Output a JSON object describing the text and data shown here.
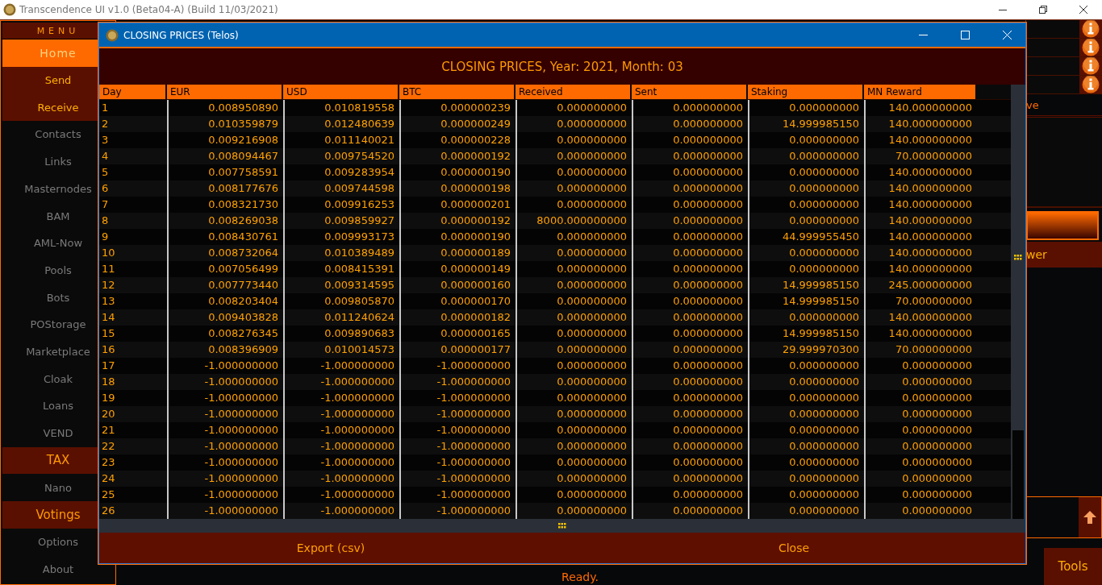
{
  "app_window": {
    "title": "Transcendence UI v1.0 (Beta04-A) (Build 11/03/2021)"
  },
  "sidebar": {
    "header": "MENU",
    "items": [
      {
        "label": "Home",
        "kind": "item",
        "selected": true,
        "disabled": false
      },
      {
        "label": "Send",
        "kind": "item",
        "selected": false,
        "disabled": false
      },
      {
        "label": "Receive",
        "kind": "item",
        "selected": false,
        "disabled": false
      },
      {
        "label": "Contacts",
        "kind": "item",
        "selected": false,
        "disabled": true
      },
      {
        "label": "Links",
        "kind": "item",
        "selected": false,
        "disabled": true
      },
      {
        "label": "Masternodes",
        "kind": "item",
        "selected": false,
        "disabled": true
      },
      {
        "label": "BAM",
        "kind": "item",
        "selected": false,
        "disabled": true
      },
      {
        "label": "AML-Now",
        "kind": "item",
        "selected": false,
        "disabled": true
      },
      {
        "label": "Pools",
        "kind": "item",
        "selected": false,
        "disabled": true
      },
      {
        "label": "Bots",
        "kind": "item",
        "selected": false,
        "disabled": true
      },
      {
        "label": "POStorage",
        "kind": "item",
        "selected": false,
        "disabled": true
      },
      {
        "label": "Marketplace",
        "kind": "item",
        "selected": false,
        "disabled": true
      },
      {
        "label": "Cloak",
        "kind": "item",
        "selected": false,
        "disabled": true
      },
      {
        "label": "Loans",
        "kind": "item",
        "selected": false,
        "disabled": true
      },
      {
        "label": "VEND",
        "kind": "item",
        "selected": false,
        "disabled": true
      },
      {
        "label": "TAX",
        "kind": "section",
        "selected": false,
        "disabled": false
      },
      {
        "label": "Nano",
        "kind": "item",
        "selected": false,
        "disabled": true
      },
      {
        "label": "Votings",
        "kind": "section",
        "selected": false,
        "disabled": false
      },
      {
        "label": "Options",
        "kind": "item",
        "selected": false,
        "disabled": true
      },
      {
        "label": "About",
        "kind": "item",
        "selected": false,
        "disabled": true
      }
    ]
  },
  "background_panel": {
    "text_1": "ve",
    "text_2": "wer",
    "status": "Ready.",
    "tools_button": "Tools"
  },
  "dialog": {
    "title": "CLOSING PRICES (Telos)",
    "heading": "CLOSING PRICES, Year: 2021, Month: 03",
    "table": {
      "columns": [
        "Day",
        "EUR",
        "USD",
        "BTC",
        "Received",
        "Sent",
        "Staking",
        "MN Reward"
      ],
      "rows": [
        [
          "1",
          "0.008950890",
          "0.010819558",
          "0.000000239",
          "0.000000000",
          "0.000000000",
          "0.000000000",
          "140.000000000"
        ],
        [
          "2",
          "0.010359879",
          "0.012480639",
          "0.000000249",
          "0.000000000",
          "0.000000000",
          "14.999985150",
          "140.000000000"
        ],
        [
          "3",
          "0.009216908",
          "0.011140021",
          "0.000000228",
          "0.000000000",
          "0.000000000",
          "0.000000000",
          "140.000000000"
        ],
        [
          "4",
          "0.008094467",
          "0.009754520",
          "0.000000192",
          "0.000000000",
          "0.000000000",
          "0.000000000",
          "70.000000000"
        ],
        [
          "5",
          "0.007758591",
          "0.009283954",
          "0.000000190",
          "0.000000000",
          "0.000000000",
          "0.000000000",
          "140.000000000"
        ],
        [
          "6",
          "0.008177676",
          "0.009744598",
          "0.000000198",
          "0.000000000",
          "0.000000000",
          "0.000000000",
          "140.000000000"
        ],
        [
          "7",
          "0.008321730",
          "0.009916253",
          "0.000000201",
          "0.000000000",
          "0.000000000",
          "0.000000000",
          "140.000000000"
        ],
        [
          "8",
          "0.008269038",
          "0.009859927",
          "0.000000192",
          "8000.000000000",
          "0.000000000",
          "0.000000000",
          "140.000000000"
        ],
        [
          "9",
          "0.008430761",
          "0.009993173",
          "0.000000190",
          "0.000000000",
          "0.000000000",
          "44.999955450",
          "140.000000000"
        ],
        [
          "10",
          "0.008732064",
          "0.010389489",
          "0.000000189",
          "0.000000000",
          "0.000000000",
          "0.000000000",
          "140.000000000"
        ],
        [
          "11",
          "0.007056499",
          "0.008415391",
          "0.000000149",
          "0.000000000",
          "0.000000000",
          "0.000000000",
          "140.000000000"
        ],
        [
          "12",
          "0.007773440",
          "0.009314595",
          "0.000000160",
          "0.000000000",
          "0.000000000",
          "14.999985150",
          "245.000000000"
        ],
        [
          "13",
          "0.008203404",
          "0.009805870",
          "0.000000170",
          "0.000000000",
          "0.000000000",
          "14.999985150",
          "70.000000000"
        ],
        [
          "14",
          "0.009403828",
          "0.011240624",
          "0.000000182",
          "0.000000000",
          "0.000000000",
          "0.000000000",
          "140.000000000"
        ],
        [
          "15",
          "0.008276345",
          "0.009890683",
          "0.000000165",
          "0.000000000",
          "0.000000000",
          "14.999985150",
          "140.000000000"
        ],
        [
          "16",
          "0.008396909",
          "0.010014573",
          "0.000000177",
          "0.000000000",
          "0.000000000",
          "29.999970300",
          "70.000000000"
        ],
        [
          "17",
          "-1.000000000",
          "-1.000000000",
          "-1.000000000",
          "0.000000000",
          "0.000000000",
          "0.000000000",
          "0.000000000"
        ],
        [
          "18",
          "-1.000000000",
          "-1.000000000",
          "-1.000000000",
          "0.000000000",
          "0.000000000",
          "0.000000000",
          "0.000000000"
        ],
        [
          "19",
          "-1.000000000",
          "-1.000000000",
          "-1.000000000",
          "0.000000000",
          "0.000000000",
          "0.000000000",
          "0.000000000"
        ],
        [
          "20",
          "-1.000000000",
          "-1.000000000",
          "-1.000000000",
          "0.000000000",
          "0.000000000",
          "0.000000000",
          "0.000000000"
        ],
        [
          "21",
          "-1.000000000",
          "-1.000000000",
          "-1.000000000",
          "0.000000000",
          "0.000000000",
          "0.000000000",
          "0.000000000"
        ],
        [
          "22",
          "-1.000000000",
          "-1.000000000",
          "-1.000000000",
          "0.000000000",
          "0.000000000",
          "0.000000000",
          "0.000000000"
        ],
        [
          "23",
          "-1.000000000",
          "-1.000000000",
          "-1.000000000",
          "0.000000000",
          "0.000000000",
          "0.000000000",
          "0.000000000"
        ],
        [
          "24",
          "-1.000000000",
          "-1.000000000",
          "-1.000000000",
          "0.000000000",
          "0.000000000",
          "0.000000000",
          "0.000000000"
        ],
        [
          "25",
          "-1.000000000",
          "-1.000000000",
          "-1.000000000",
          "0.000000000",
          "0.000000000",
          "0.000000000",
          "0.000000000"
        ],
        [
          "26",
          "-1.000000000",
          "-1.000000000",
          "-1.000000000",
          "0.000000000",
          "0.000000000",
          "0.000000000",
          "0.000000000"
        ]
      ]
    },
    "buttons": [
      "Export (csv)",
      "Close"
    ]
  }
}
